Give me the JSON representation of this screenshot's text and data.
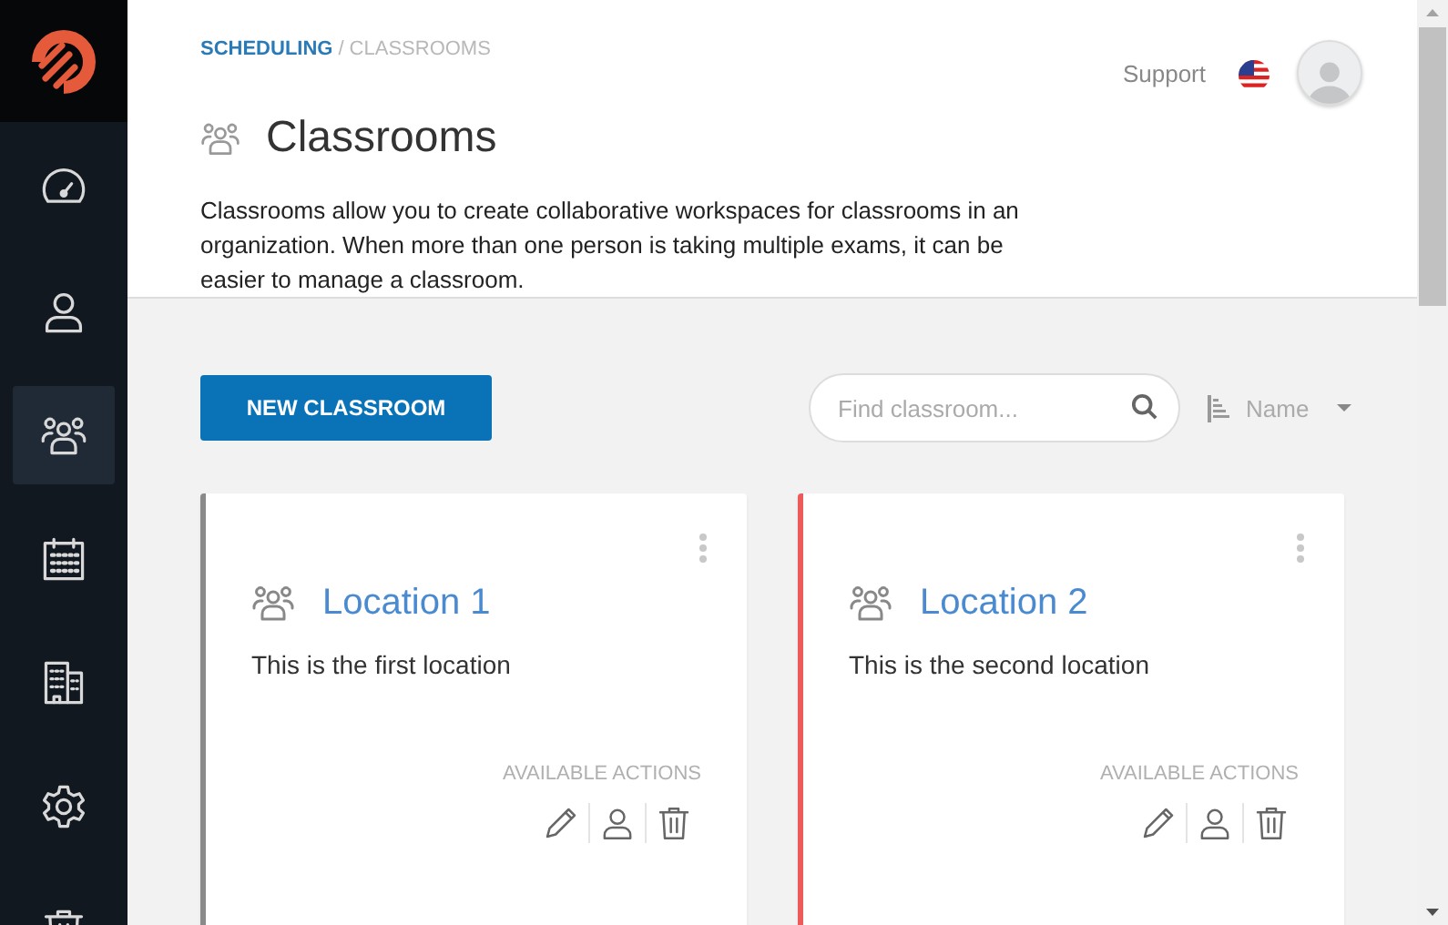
{
  "sidebar": {
    "items": [
      {
        "selected": false
      },
      {
        "selected": false
      },
      {
        "selected": true
      },
      {
        "selected": false
      },
      {
        "selected": false
      },
      {
        "selected": false
      },
      {
        "selected": false
      }
    ]
  },
  "breadcrumb": [
    {
      "label": "SCHEDULING",
      "kind": "link"
    },
    {
      "label": "/",
      "kind": "separator"
    },
    {
      "label": "CLASSROOMS",
      "kind": "current"
    }
  ],
  "header": {
    "support": "Support",
    "title": "Classrooms",
    "description": "Classrooms allow you to create collaborative workspaces for classrooms in an organization. When more than one person is taking multiple exams, it can be easier to manage a classroom."
  },
  "toolbar": {
    "new_button": "NEW CLASSROOM",
    "search": {
      "placeholder": "Find classroom..."
    },
    "sort": "Name"
  },
  "cards": [
    {
      "title": "Location 1",
      "description": "This is the first location",
      "actions_label": "AVAILABLE ACTIONS",
      "color": "#8a8a8a"
    },
    {
      "title": "Location 2",
      "description": "This is the second location",
      "actions_label": "AVAILABLE ACTIONS",
      "color": "#ec5a5a"
    }
  ]
}
